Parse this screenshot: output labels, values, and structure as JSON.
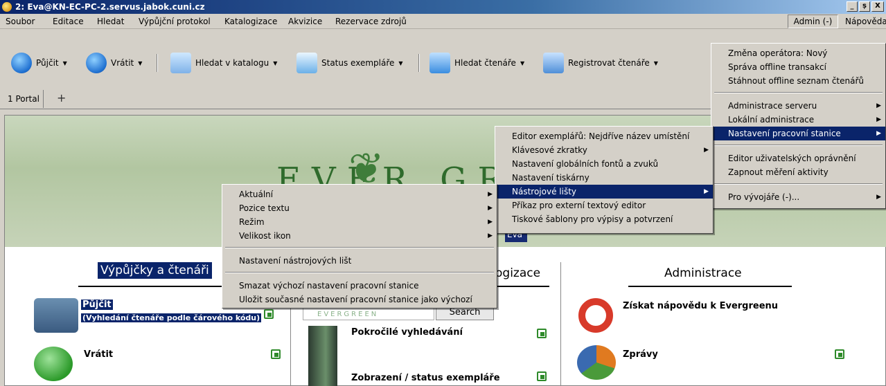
{
  "window": {
    "title": "2: Eva@KN-EC-PC-2.servus.jabok.cuni.cz",
    "controls": [
      "_",
      "ș",
      "X"
    ]
  },
  "menubar": {
    "items": [
      "Soubor",
      "Editace",
      "Hledat",
      "Výpůjční protokol",
      "Katalogizace",
      "Akvizice",
      "Rezervace zdrojů"
    ],
    "admin": "Admin (-)",
    "help": "Nápověda"
  },
  "toolbar": [
    {
      "label": "Půjčit"
    },
    {
      "label": "Vrátit"
    },
    {
      "label": "Hledat v katalogu"
    },
    {
      "label": "Status exempláře"
    },
    {
      "label": "Hledat čtenáře"
    },
    {
      "label": "Registrovat čtenáře"
    }
  ],
  "tabs": {
    "portal": "1 Portal",
    "add": "+"
  },
  "portal": {
    "logo": "EVER GREEN",
    "badge": "Eva",
    "col1": {
      "title": "Výpůjčky a čtenáři",
      "items": [
        {
          "title": "Půjčit",
          "sub": "(Vyhledání čtenáře podle čárového kódu)"
        },
        {
          "title": "Vrátit"
        }
      ]
    },
    "col2": {
      "title": "ogizace",
      "search_btn": "Search",
      "search_brand": "EVERGREEN",
      "items": [
        "Pokročilé vyhledávání",
        "Zobrazení / status exempláře"
      ]
    },
    "col3": {
      "title": "Administrace",
      "items": [
        "Získat nápovědu k Evergreenu",
        "Zprávy"
      ]
    }
  },
  "admin_menu": {
    "items": [
      "Změna operátora: Nový",
      "Správa offline transakcí",
      "Stáhnout offline seznam čtenářů",
      "Administrace serveru",
      "Lokální administrace",
      "Nastavení pracovní stanice",
      "Editor uživatelských oprávnění",
      "Zapnout měření aktivity",
      "Pro vývojáře (-)..."
    ]
  },
  "workstation_menu": {
    "items": [
      "Editor exemplářů: Nejdříve název umístění",
      "Klávesové zkratky",
      "Nastavení globálních fontů a zvuků",
      "Nastavení tiskárny",
      "Nástrojové lišty",
      "Příkaz pro externí textový editor",
      "Tiskové šablony pro výpisy a potvrzení"
    ]
  },
  "toolbar_menu": {
    "items": [
      "Aktuální",
      "Pozice textu",
      "Režim",
      "Velikost ikon",
      "Nastavení nástrojových lišt",
      "Smazat výchozí nastavení pracovní stanice",
      "Uložit současné nastavení pracovní stanice jako výchozí"
    ]
  },
  "colors": {
    "highlight": "#0a246a",
    "face": "#d4d0c8",
    "brand_green": "#2f6b2c"
  }
}
